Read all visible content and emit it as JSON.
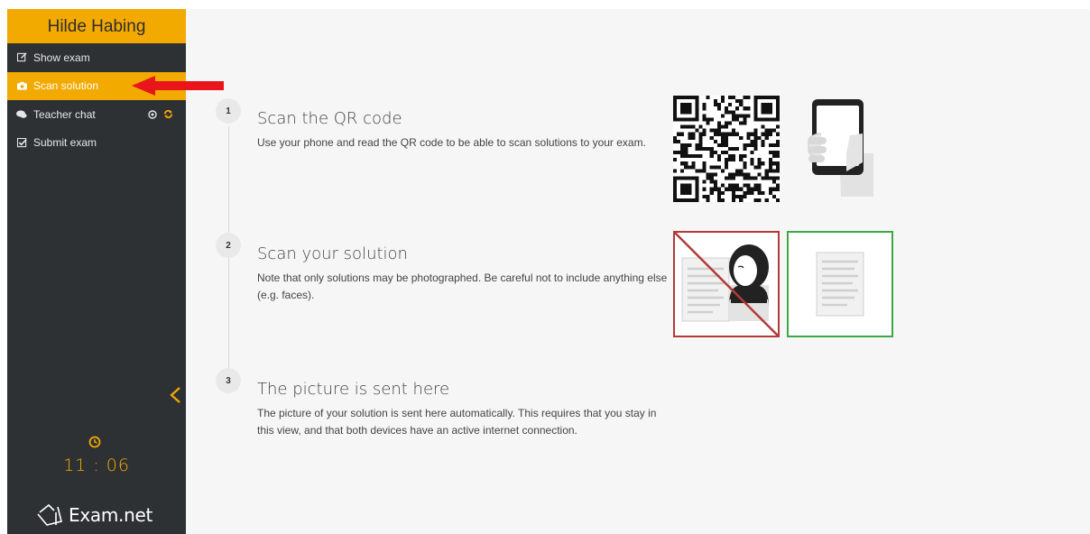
{
  "sidebar": {
    "user_name": "Hilde Habing",
    "items": [
      {
        "label": "Show exam",
        "icon": "edit-icon",
        "active": false
      },
      {
        "label": "Scan solution",
        "icon": "camera-icon",
        "active": true
      },
      {
        "label": "Teacher chat",
        "icon": "chat-icon",
        "active": false
      },
      {
        "label": "Submit exam",
        "icon": "checkbox-icon",
        "active": false
      }
    ],
    "timer": "11 : 06",
    "logo_text": "Exam.net"
  },
  "steps": [
    {
      "number": "1",
      "title": "Scan the QR code",
      "description": "Use your phone and read the QR code to be able to scan solutions to your exam."
    },
    {
      "number": "2",
      "title": "Scan your solution",
      "description": "Note that only solutions may be photographed. Be careful not to include anything else (e.g. faces)."
    },
    {
      "number": "3",
      "title": "The picture is sent here",
      "description": "The picture of your solution is sent here automatically. This requires that you stay in this view, and that both devices have an active internet connection."
    }
  ],
  "colors": {
    "accent": "#f2a900",
    "sidebar_bg": "#2e3134",
    "content_bg": "#f6f6f6",
    "annotation_arrow": "#e8151a",
    "bad_frame": "#b23a3a",
    "good_frame": "#3aa845"
  }
}
